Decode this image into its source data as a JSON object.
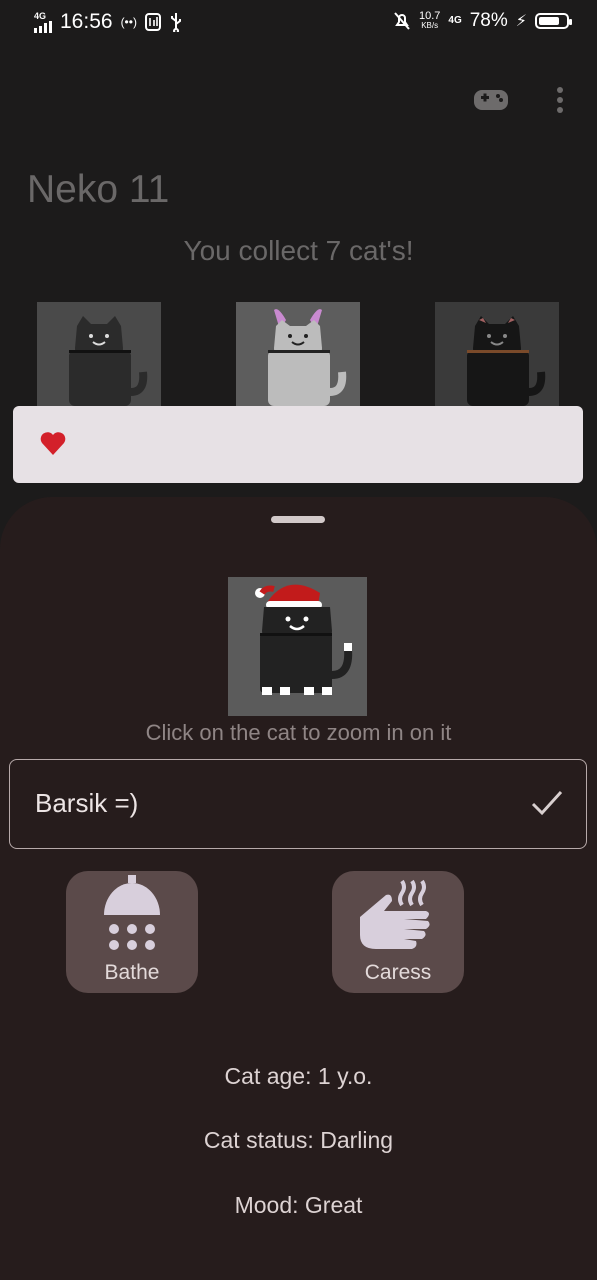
{
  "status_bar": {
    "network_type": "4G",
    "time": "16:56",
    "speed_value": "10.7",
    "speed_unit": "KB/s",
    "network_type_2": "4G",
    "battery_percent": "78%",
    "battery_level": 0.78
  },
  "app": {
    "title": "Neko 11",
    "collect_text": "You collect 7 cat's!",
    "toolbar_icons": [
      "gamepad-icon",
      "more-vert-icon"
    ]
  },
  "snackbar": {
    "icon": "heart-icon"
  },
  "sheet": {
    "zoom_hint": "Click on the cat to zoom in on it",
    "name_value": "Barsik =)",
    "actions": [
      {
        "label": "Bathe",
        "icon": "shower-icon"
      },
      {
        "label": "Caress",
        "icon": "caress-hand-icon"
      }
    ],
    "info": {
      "age": "Cat age: 1 y.o.",
      "status": "Cat status: Darling",
      "mood": "Mood: Great"
    }
  },
  "colors": {
    "background": "#1c1b1b",
    "sheet": "#261c1c",
    "action_button": "#5b4a4a",
    "snackbar": "#e7e1e5",
    "accent_heart": "#d3202a"
  }
}
